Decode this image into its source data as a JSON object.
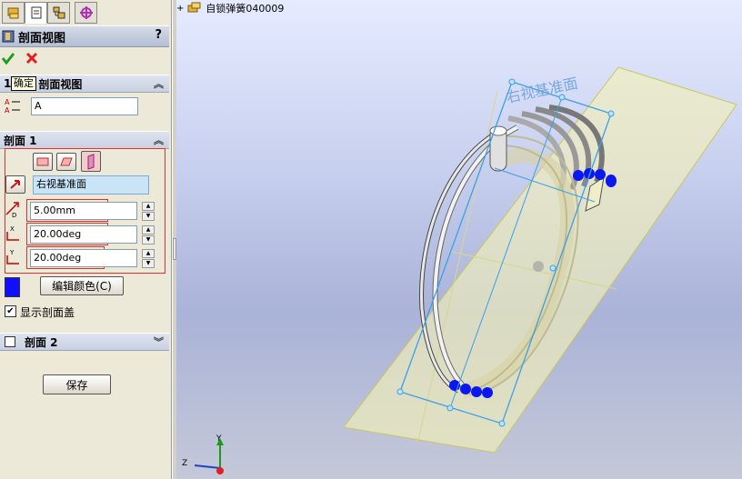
{
  "panel": {
    "title": "剖面视图",
    "help": "?",
    "tooltip": "确定",
    "section_group": {
      "index": "1",
      "label": "剖面视图",
      "name_value": "A"
    },
    "section1": {
      "title": "剖面 1",
      "plane": "右视基准面",
      "offset": "5.00mm",
      "angle_x": "20.00deg",
      "angle_y": "20.00deg",
      "edit_color": "编辑颜色(C)",
      "show_cap": "显示剖面盖",
      "show_cap_checked": true,
      "cap_color": "#1010ff"
    },
    "section2": {
      "title": "剖面 2",
      "checked": false
    },
    "save": "保存",
    "axis_labels": {
      "d": "D",
      "x": "X",
      "y": "Y"
    }
  },
  "tree": {
    "expander": "+",
    "item": "自锁弹簧040009"
  },
  "viewport": {
    "plane_label": "右视基准面",
    "triad": {
      "z": "Z",
      "y": "Y"
    }
  }
}
